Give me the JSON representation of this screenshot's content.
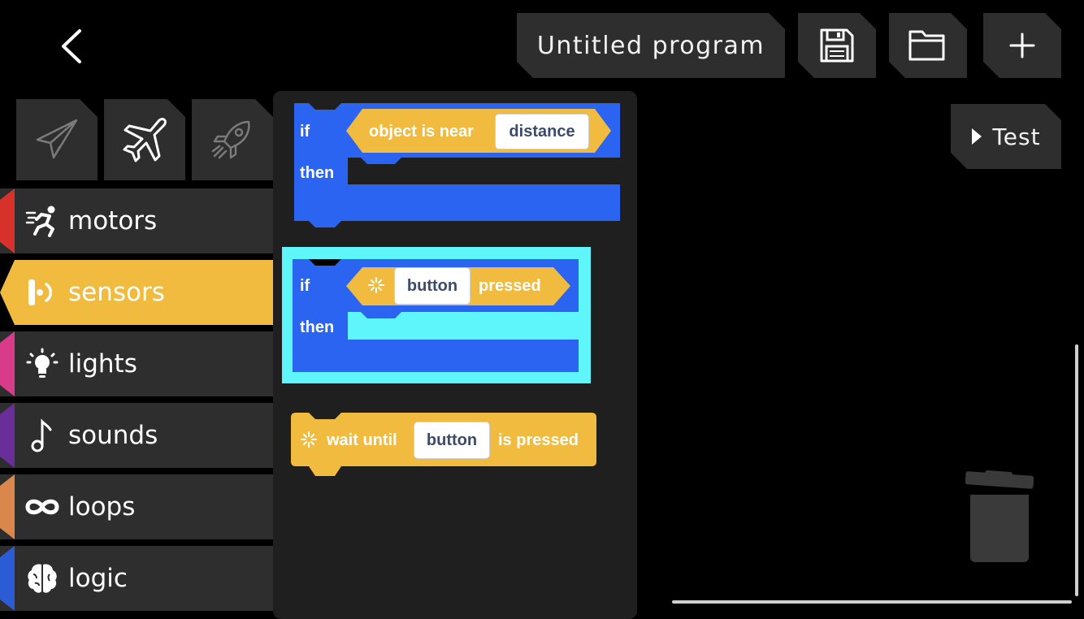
{
  "header": {
    "program_title": "Untitled program",
    "back_icon": "chevron-left-icon",
    "save_icon": "floppy-disk-icon",
    "open_icon": "folder-icon",
    "new_icon": "plus-icon",
    "test_label": "Test",
    "test_icon": "play-icon"
  },
  "vehicles": [
    {
      "name": "paper-plane",
      "icon": "paper-plane-icon"
    },
    {
      "name": "airplane",
      "icon": "airplane-icon",
      "selected": true
    },
    {
      "name": "rocket",
      "icon": "rocket-icon"
    }
  ],
  "categories": [
    {
      "label": "motors",
      "icon": "running-figure-icon",
      "color": "#d6312b"
    },
    {
      "label": "sensors",
      "icon": "sensor-icon",
      "color": "#f0bb3f",
      "active": true
    },
    {
      "label": "lights",
      "icon": "lightbulb-icon",
      "color": "#d83b8a"
    },
    {
      "label": "sounds",
      "icon": "music-note-icon",
      "color": "#6a2e9a"
    },
    {
      "label": "loops",
      "icon": "infinity-loop-icon",
      "color": "#d9874a"
    },
    {
      "label": "logic",
      "icon": "brain-icon",
      "color": "#2b5cd6"
    }
  ],
  "blocks": {
    "if_near": {
      "if_label": "if",
      "condition_text": "object is near",
      "condition_value": "distance",
      "then_label": "then"
    },
    "if_pressed": {
      "if_label": "if",
      "button_value": "button",
      "pressed_text": "pressed",
      "then_label": "then"
    },
    "wait_until": {
      "prefix": "wait until",
      "button_value": "button",
      "suffix": "is pressed"
    }
  },
  "colors": {
    "logic_blue": "#2b64f0",
    "sensor_yellow": "#f0bb3f",
    "highlight_cyan": "#5ff6fb",
    "panel": "#2e2e2e"
  }
}
